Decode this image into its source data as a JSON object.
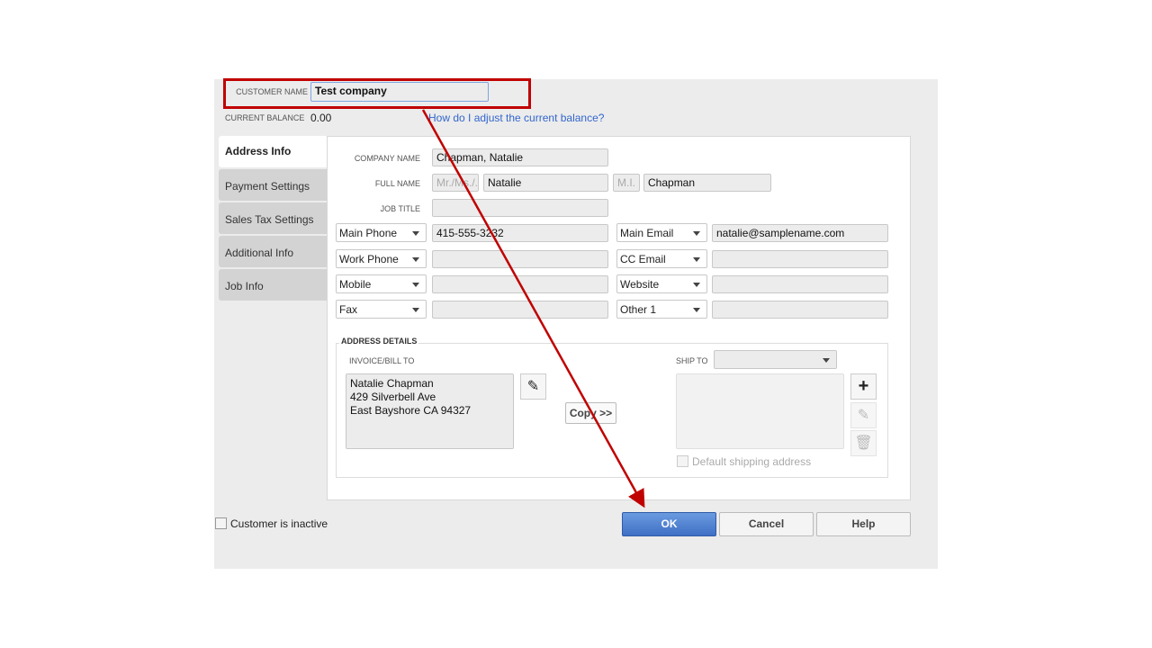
{
  "header": {
    "customer_name_label": "CUSTOMER NAME",
    "customer_name": "Test company",
    "balance_label": "CURRENT BALANCE",
    "balance": "0.00",
    "help_link": "How do I adjust the current balance?"
  },
  "tabs": [
    {
      "label": "Address Info"
    },
    {
      "label": "Payment Settings"
    },
    {
      "label": "Sales Tax Settings"
    },
    {
      "label": "Additional Info"
    },
    {
      "label": "Job Info"
    }
  ],
  "form": {
    "company_name_label": "COMPANY NAME",
    "company_name": "Chapman, Natalie",
    "full_name_label": "FULL NAME",
    "title_placeholder": "Mr./Ms./...",
    "first_name": "Natalie",
    "mi_placeholder": "M.I.",
    "last_name": "Chapman",
    "job_title_label": "JOB TITLE",
    "job_title": "",
    "phones": [
      {
        "type": "Main Phone",
        "value": "415-555-3232"
      },
      {
        "type": "Work Phone",
        "value": ""
      },
      {
        "type": "Mobile",
        "value": ""
      },
      {
        "type": "Fax",
        "value": ""
      }
    ],
    "contacts": [
      {
        "type": "Main Email",
        "value": "natalie@samplename.com"
      },
      {
        "type": "CC Email",
        "value": ""
      },
      {
        "type": "Website",
        "value": ""
      },
      {
        "type": "Other 1",
        "value": ""
      }
    ]
  },
  "address": {
    "section_label": "ADDRESS DETAILS",
    "bill_label": "INVOICE/BILL TO",
    "bill_lines": [
      "Natalie Chapman",
      "429 Silverbell Ave",
      "East Bayshore CA  94327"
    ],
    "copy_label": "Copy >>",
    "ship_label": "SHIP TO",
    "ship_value": "",
    "default_ship_label": "Default shipping address"
  },
  "footer": {
    "inactive_label": "Customer is inactive",
    "ok": "OK",
    "cancel": "Cancel",
    "help": "Help"
  },
  "colors": {
    "highlight": "#c00000",
    "ok": "#4a7cd0",
    "link": "#3366cc"
  }
}
